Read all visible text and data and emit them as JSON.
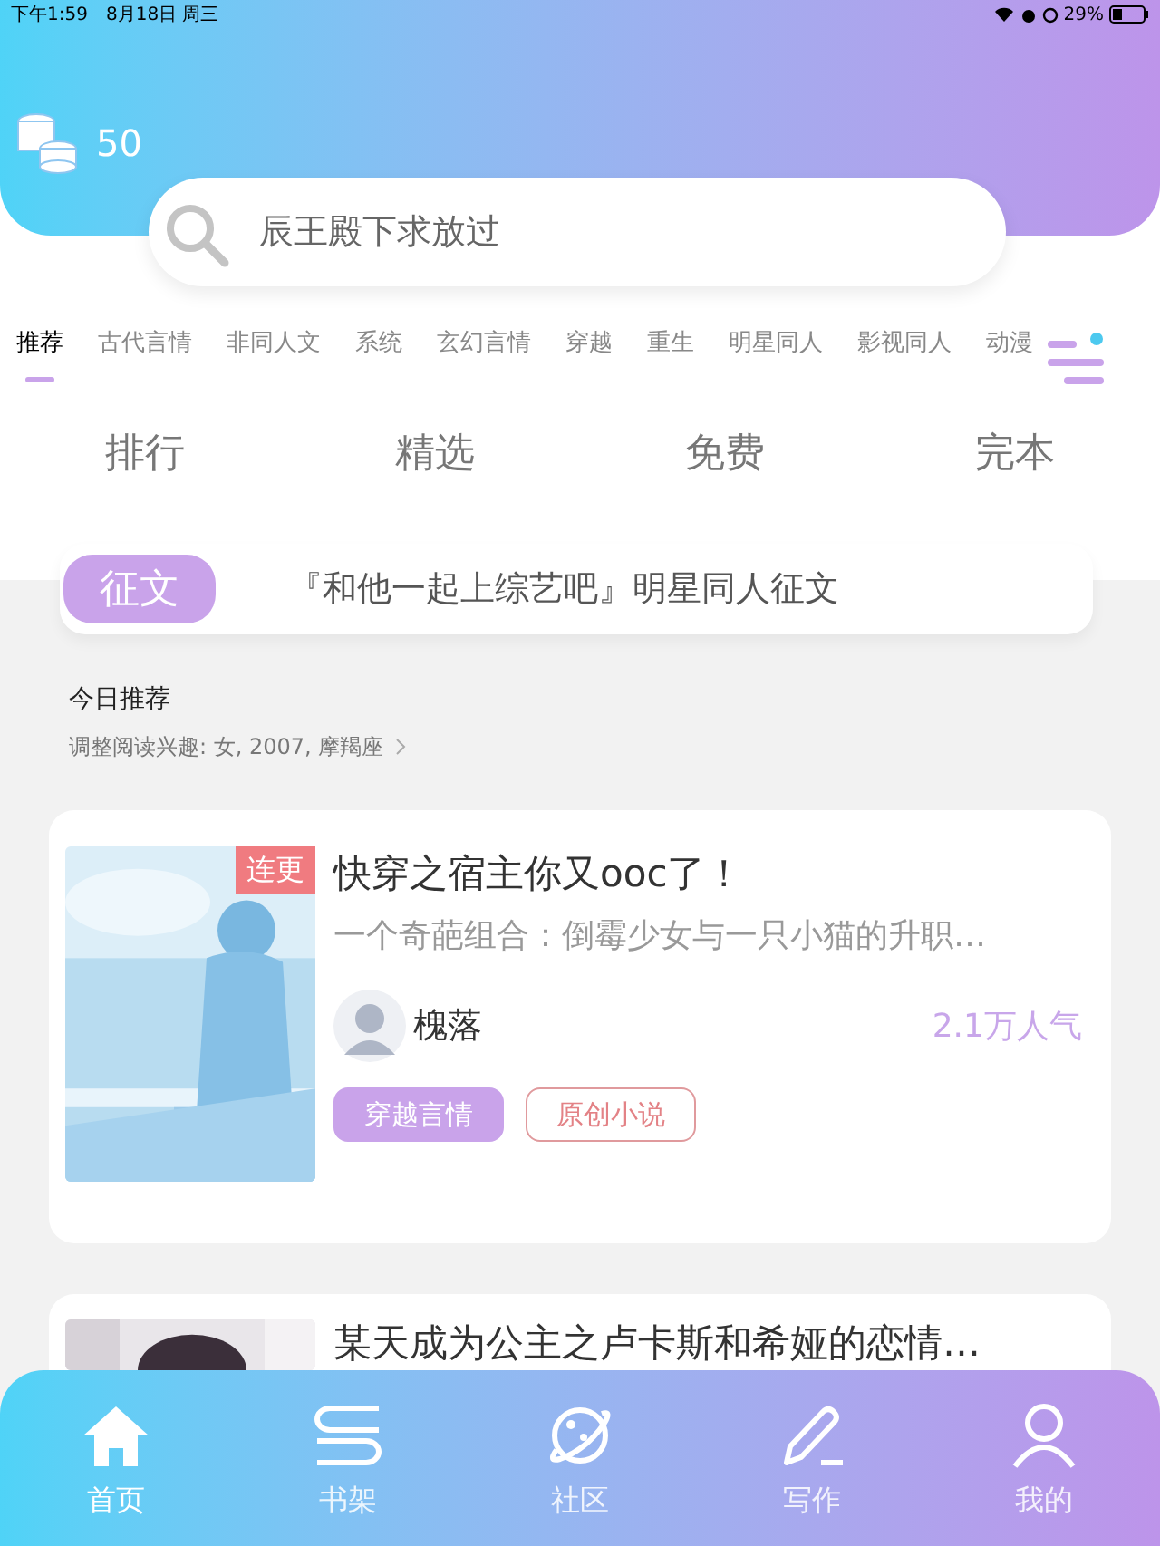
{
  "status_bar": {
    "time": "下午1:59",
    "date": "8月18日 周三",
    "battery": "29%"
  },
  "header": {
    "coins": "50",
    "search": {
      "placeholder": "辰王殿下求放过"
    }
  },
  "tabs": [
    {
      "label": "推荐",
      "selected": true
    },
    {
      "label": "古代言情",
      "selected": false
    },
    {
      "label": "非同人文",
      "selected": false
    },
    {
      "label": "系统",
      "selected": false
    },
    {
      "label": "玄幻言情",
      "selected": false
    },
    {
      "label": "穿越",
      "selected": false
    },
    {
      "label": "重生",
      "selected": false
    },
    {
      "label": "明星同人",
      "selected": false
    },
    {
      "label": "影视同人",
      "selected": false
    },
    {
      "label": "动漫",
      "selected": false
    }
  ],
  "categories": [
    "排行",
    "精选",
    "免费",
    "完本"
  ],
  "contest": {
    "badge": "征文",
    "title": "『和他一起上综艺吧』明星同人征文"
  },
  "today": {
    "title": "今日推荐",
    "subtitle": "调整阅读兴趣: 女, 2007, 摩羯座"
  },
  "books": [
    {
      "title": "快穿之宿主你又ooc了！",
      "badge": "连更",
      "summary": "一个奇葩组合：倒霉少女与一只小猫的升职…",
      "author": "槐落",
      "popularity": "2.1万人气",
      "tags": [
        {
          "label": "穿越言情",
          "kind": "filled"
        },
        {
          "label": "原创小说",
          "kind": "outline"
        }
      ]
    },
    {
      "title": "某天成为公主之卢卡斯和希娅的恋情…"
    }
  ],
  "bottom_nav": [
    {
      "label": "首页",
      "selected": true
    },
    {
      "label": "书架",
      "selected": false
    },
    {
      "label": "社区",
      "selected": false
    },
    {
      "label": "写作",
      "selected": false
    },
    {
      "label": "我的",
      "selected": false
    }
  ]
}
